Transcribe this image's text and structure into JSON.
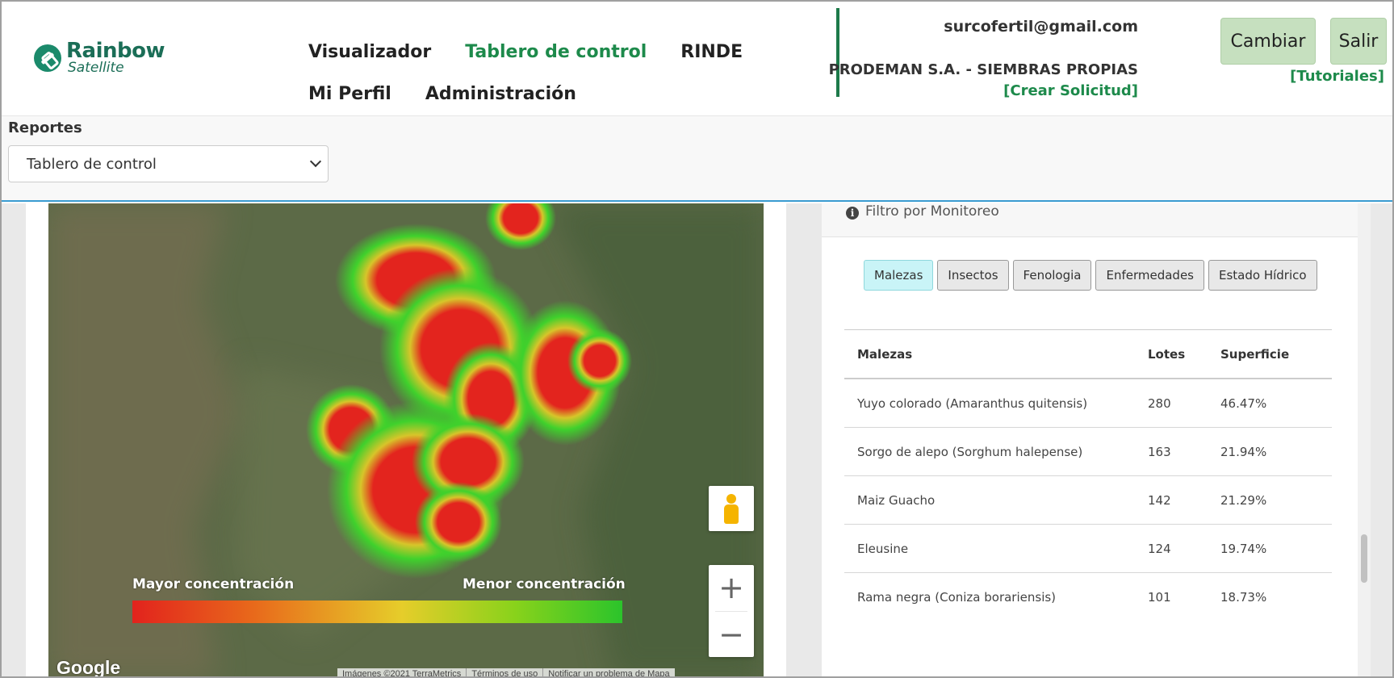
{
  "brand": {
    "name": "Rainbow",
    "sub": "Satellite",
    "color": "#1b6e57"
  },
  "nav": {
    "row1": [
      {
        "label": "Visualizador",
        "active": false
      },
      {
        "label": "Tablero de control",
        "active": true
      },
      {
        "label": "RINDE",
        "active": false
      }
    ],
    "row2": [
      {
        "label": "Mi Perfil",
        "active": false
      },
      {
        "label": "Administración",
        "active": false
      }
    ]
  },
  "account": {
    "email": "surcofertil@gmail.com",
    "company": "PRODEMAN S.A. - SIEMBRAS PROPIAS",
    "create_request": "[Crear Solicitud]"
  },
  "header_buttons": {
    "change": "Cambiar",
    "exit": "Salir",
    "tutorials": "[Tutoriales]"
  },
  "reports": {
    "label": "Reportes",
    "selected": "Tablero de control"
  },
  "map": {
    "legend_left": "Mayor concentración",
    "legend_right": "Menor concentración",
    "google": "Google",
    "attribution": [
      "Imágenes ©2021 TerraMetrics",
      "Términos de uso",
      "Notificar un problema de Mapa"
    ],
    "zoom_in": "+",
    "zoom_out": "−"
  },
  "filter": {
    "title": "Filtro por Monitoreo",
    "tabs": [
      "Malezas",
      "Insectos",
      "Fenologia",
      "Enfermedades",
      "Estado Hídrico"
    ],
    "active_tab": 0
  },
  "table": {
    "headers": [
      "Malezas",
      "Lotes",
      "Superficie"
    ],
    "rows": [
      [
        "Yuyo colorado (Amaranthus quitensis)",
        "280",
        "46.47%"
      ],
      [
        "Sorgo de alepo (Sorghum halepense)",
        "163",
        "21.94%"
      ],
      [
        "Maiz Guacho",
        "142",
        "21.29%"
      ],
      [
        "Eleusine",
        "124",
        "19.74%"
      ],
      [
        "Rama negra (Coniza borariensis)",
        "101",
        "18.73%"
      ]
    ]
  },
  "colors": {
    "accent": "#1d8a4b",
    "button_bg": "#c6e0bf",
    "active_tab": "#c9f4f7",
    "divider_blue": "#3a9bd1"
  }
}
